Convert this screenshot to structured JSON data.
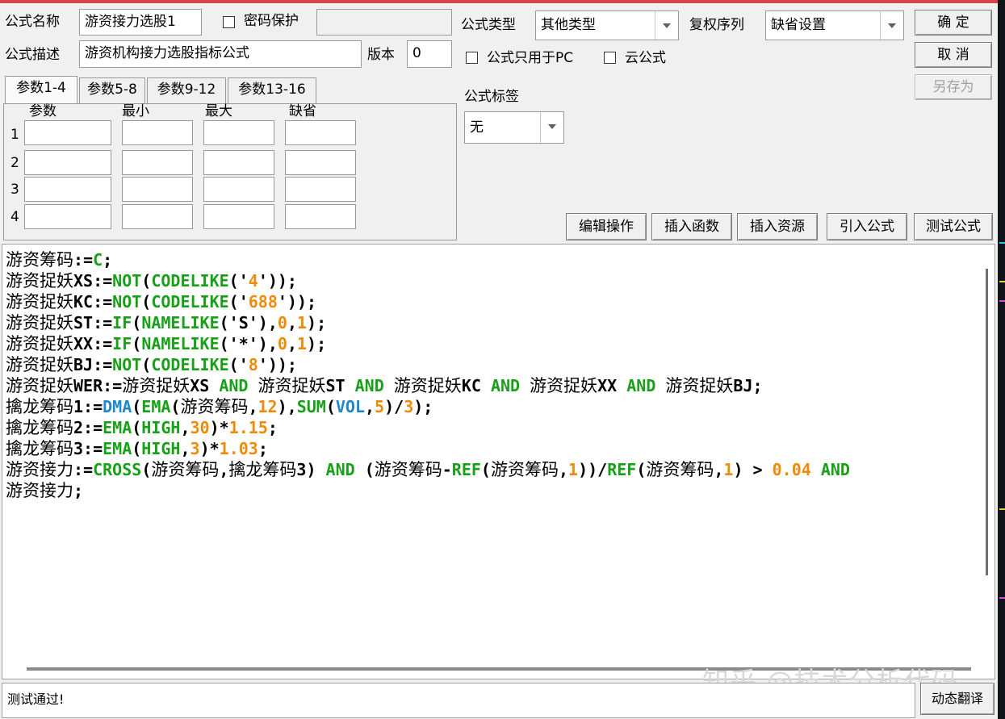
{
  "formula": {
    "name_label": "公式名称",
    "name_value": "游资接力选股1",
    "password_label": "密码保护",
    "password_value": "",
    "desc_label": "公式描述",
    "desc_value": "游资机构接力选股指标公式",
    "version_label": "版本",
    "version_value": "0",
    "type_label": "公式类型",
    "type_value": "其他类型",
    "rights_label": "复权序列",
    "rights_value": "缺省设置",
    "pc_only_label": "公式只用于PC",
    "cloud_label": "云公式",
    "tag_label": "公式标签",
    "tag_value": "无"
  },
  "buttons": {
    "ok": "确 定",
    "cancel": "取 消",
    "save_as": "另存为",
    "edit_ops": "编辑操作",
    "insert_func": "插入函数",
    "insert_res": "插入资源",
    "import_formula": "引入公式",
    "test_formula": "测试公式",
    "dynamic_translate": "动态翻译"
  },
  "tabs": [
    {
      "label": "参数1-4"
    },
    {
      "label": "参数5-8"
    },
    {
      "label": "参数9-12"
    },
    {
      "label": "参数13-16"
    }
  ],
  "params": {
    "headers": [
      "参数",
      "最小",
      "最大",
      "缺省"
    ],
    "rows": [
      "1",
      "2",
      "3",
      "4"
    ]
  },
  "code_lines": [
    "游资筹码:=C;",
    "游资捉妖XS:=NOT(CODELIKE('4'));",
    "游资捉妖KC:=NOT(CODELIKE('688'));",
    "游资捉妖ST:=IF(NAMELIKE('S'),0,1);",
    "游资捉妖XX:=IF(NAMELIKE('*'),0,1);",
    "游资捉妖BJ:=NOT(CODELIKE('8'));",
    "游资捉妖WER:=游资捉妖XS AND 游资捉妖ST AND 游资捉妖KC AND 游资捉妖XX AND 游资捉妖BJ;",
    "擒龙筹码1:=DMA(EMA(游资筹码,12),SUM(VOL,5)/3);",
    "擒龙筹码2:=EMA(HIGH,30)*1.15;",
    "擒龙筹码3:=EMA(HIGH,3)*1.03;",
    "游资接力:=CROSS(游资筹码,擒龙筹码3) AND (游资筹码-REF(游资筹码,1))/REF(游资筹码,1) > 0.04 AND",
    "游资接力;"
  ],
  "status_text": "测试通过!",
  "watermark": "知乎 @技术分析代码",
  "colors": {
    "keyword_green": "#18a018",
    "number_orange": "#f08a0a",
    "function_blue": "#1e88c8",
    "title_bar_red": "#d8434b"
  }
}
